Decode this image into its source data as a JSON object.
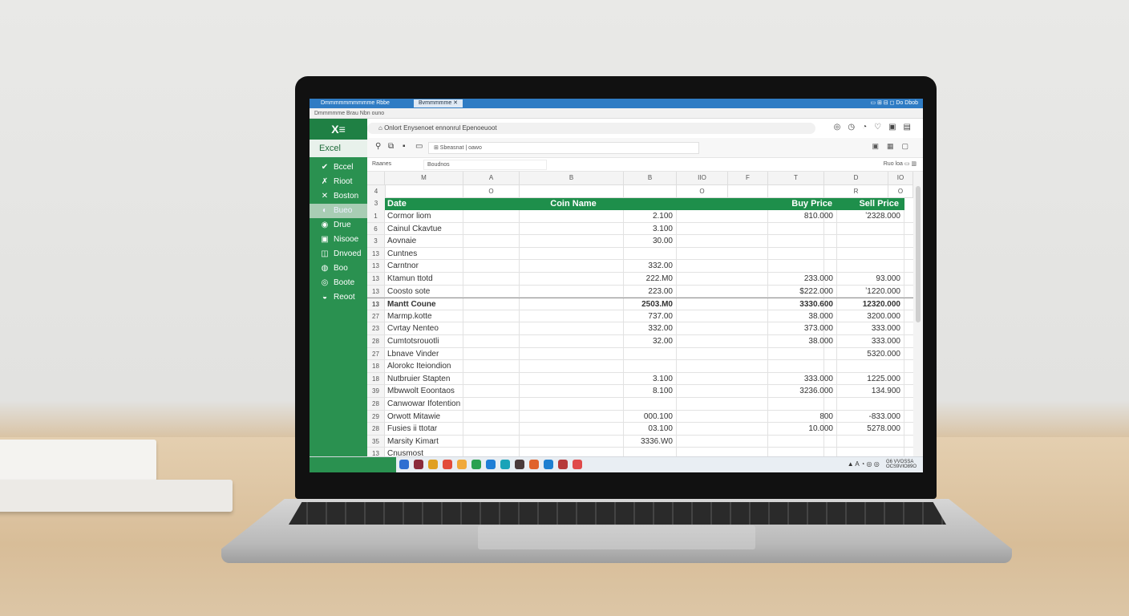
{
  "titlebar": {
    "tab1": "Dmmmmmmmmmme  Rbbe",
    "tab2": "Bvmmmmme  ✕",
    "ctrls": "▭  ⊞  ⊟  ◻  Do  Dbob"
  },
  "tabstrip": {
    "text": "Dmmmmme   Brau  Nbn ouno"
  },
  "sidebar": {
    "brand": "X≡",
    "app_name": "Excel",
    "items": [
      {
        "icon": "✔",
        "label": "Bccel"
      },
      {
        "icon": "✗",
        "label": "Rioot"
      },
      {
        "icon": "✕",
        "label": "Boston"
      },
      {
        "icon": "◐",
        "label": "Bueo"
      },
      {
        "icon": "◉",
        "label": "Drue"
      },
      {
        "icon": "▣",
        "label": "Nisooe"
      },
      {
        "icon": "◫",
        "label": "Dnvoed"
      },
      {
        "icon": "◍",
        "label": "Boo"
      },
      {
        "icon": "◎",
        "label": "Boote"
      },
      {
        "icon": "◒",
        "label": "Reoot"
      }
    ]
  },
  "address": {
    "url": "Onlort Enysenoet ennonrul Epenoeuoot"
  },
  "toolbar": {
    "search": "⊞ Sbeasnat  |  oawo"
  },
  "formula": {
    "name_box": "Raanes",
    "formula": "Boudnos",
    "right": "Ruo loa  ▭  ▥"
  },
  "columns": [
    "",
    "M",
    "A",
    "B",
    "B",
    "IIO",
    "F",
    "T",
    "D",
    "IO"
  ],
  "columns2": [
    "",
    "",
    "O",
    "",
    "",
    "O",
    "",
    "",
    "R",
    "O"
  ],
  "top_row_nums": [
    "4",
    "4"
  ],
  "header": {
    "num": "3",
    "date": "Date",
    "coin": "Coin Name",
    "buy": "Buy Price",
    "sell": "Sell Price"
  },
  "rows": [
    {
      "n": "1",
      "name": "Cormor liom",
      "amt": "2.100",
      "buy": "810.000",
      "sell": "ʼ2328.000"
    },
    {
      "n": "6",
      "name": "Cainul Ckavtue",
      "amt": "3.100",
      "buy": "",
      "sell": ""
    },
    {
      "n": "3",
      "name": "Aovnaie",
      "amt": "30.00",
      "buy": "",
      "sell": ""
    },
    {
      "n": "13",
      "name": "Cuntnes",
      "amt": "",
      "buy": "",
      "sell": ""
    },
    {
      "n": "13",
      "name": "Carntnor",
      "amt": "332.00",
      "buy": "",
      "sell": ""
    },
    {
      "n": "13",
      "name": "Ktamun ttotd",
      "amt": "222.M0",
      "buy": "233.000",
      "sell": "93.000"
    },
    {
      "n": "13",
      "name": "Coosto sote",
      "amt": "223.00",
      "buy": "$222.000",
      "sell": "ʼ1220.000"
    },
    {
      "n": "13",
      "name": "Mantt Coune",
      "amt": "2503.M0",
      "buy": "3330.600",
      "sell": "12320.000",
      "bold": true
    },
    {
      "n": "27",
      "name": "Marmp.kotte",
      "amt": "737.00",
      "buy": "38.000",
      "sell": "3200.000"
    },
    {
      "n": "23",
      "name": "Cvrtay Nenteo",
      "amt": "332.00",
      "buy": "373.000",
      "sell": "333.000"
    },
    {
      "n": "28",
      "name": "Cumtotsrouotli",
      "amt": "32.00",
      "buy": "38.000",
      "sell": "333.000"
    },
    {
      "n": "27",
      "name": "Lbnave Vinder",
      "amt": "",
      "buy": "",
      "sell": "5320.000"
    },
    {
      "n": "18",
      "name": "Alorokc Iteiondion",
      "amt": "",
      "buy": "",
      "sell": ""
    },
    {
      "n": "18",
      "name": "Nutbruier Stapten",
      "amt": "3.100",
      "buy": "333.000",
      "sell": "1225.000"
    },
    {
      "n": "39",
      "name": "Mbwwolt Eoontaos",
      "amt": "8.100",
      "buy": "3236.000",
      "sell": "134.900"
    },
    {
      "n": "28",
      "name": "Canwowar Ifotention",
      "amt": "",
      "buy": "",
      "sell": ""
    },
    {
      "n": "29",
      "name": "Orwott Mitawie",
      "amt": "000.100",
      "buy": "800",
      "sell": "-833.000"
    },
    {
      "n": "28",
      "name": "Fusies ii ttotar",
      "amt": "03.100",
      "buy": "10.000",
      "sell": "5278.000"
    },
    {
      "n": "35",
      "name": "Marsity Kimart",
      "amt": "3336.W0",
      "buy": "",
      "sell": ""
    },
    {
      "n": "13",
      "name": "Cnusmost",
      "amt": "",
      "buy": "",
      "sell": ""
    }
  ],
  "taskbar": {
    "icon_colors": [
      "#2f6fd1",
      "#8b2b3b",
      "#e0a020",
      "#e24b3a",
      "#f0a93a",
      "#2aa150",
      "#1e7ed6",
      "#1aa3b8",
      "#4a3a3a",
      "#e0632b",
      "#1f7fd0",
      "#b63a3a",
      "#e04a4a"
    ],
    "tray": "▲  A  ◔  ◎  ◎",
    "clock_line1": "G6 VVOSSA",
    "clock_line2": "OCS9VIO89O"
  }
}
